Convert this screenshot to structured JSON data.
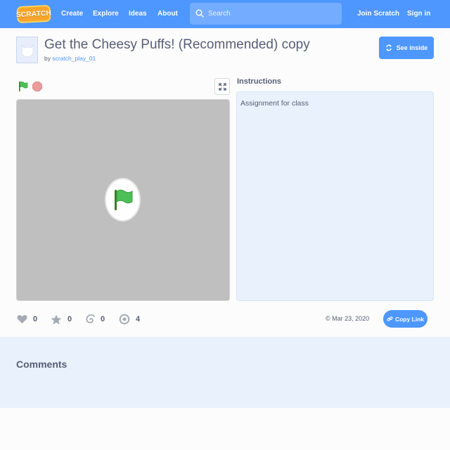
{
  "nav": {
    "logo_text": "SCRATCH",
    "links": [
      "Create",
      "Explore",
      "Ideas",
      "About"
    ],
    "search_placeholder": "Search",
    "join": "Join Scratch",
    "signin": "Sign in",
    "color": "#4d97ff"
  },
  "project": {
    "title": "Get the Cheesy Puffs! (Recommended) copy",
    "by": "by",
    "author": "scratch_play_01",
    "see_inside": "See inside"
  },
  "instructions": {
    "heading": "Instructions",
    "text": "Assignment for class"
  },
  "stats": {
    "loves": "0",
    "favorites": "0",
    "remixes": "0",
    "views": "4",
    "date": "© Mar 23, 2020",
    "copy_link": "Copy Link"
  },
  "comments": {
    "heading": "Comments"
  },
  "icons": {
    "flag": "green-flag-icon",
    "stop": "stop-icon",
    "fullscreen": "fullscreen-icon",
    "love": "heart-icon",
    "favorite": "star-icon",
    "remix": "remix-icon",
    "views": "eye-icon",
    "link": "link-icon",
    "see_inside": "refresh-icon"
  }
}
